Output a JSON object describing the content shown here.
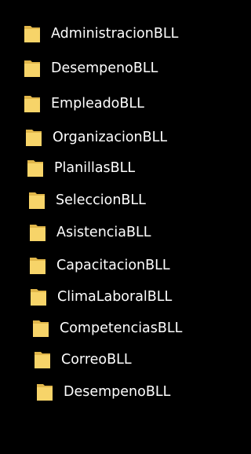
{
  "folders": [
    {
      "label": "AdministracionBLL",
      "icon": "folder-icon"
    },
    {
      "label": "DesempenoBLL",
      "icon": "folder-icon"
    },
    {
      "label": "EmpleadoBLL",
      "icon": "folder-icon"
    },
    {
      "label": "OrganizacionBLL",
      "icon": "folder-icon"
    },
    {
      "label": "PlanillasBLL",
      "icon": "folder-icon"
    },
    {
      "label": "SeleccionBLL",
      "icon": "folder-icon"
    },
    {
      "label": "AsistenciaBLL",
      "icon": "folder-icon"
    },
    {
      "label": "CapacitacionBLL",
      "icon": "folder-icon"
    },
    {
      "label": "ClimaLaboralBLL",
      "icon": "folder-icon"
    },
    {
      "label": "CompetenciasBLL",
      "icon": "folder-icon"
    },
    {
      "label": "CorreoBLL",
      "icon": "folder-icon"
    },
    {
      "label": "DesempenoBLL",
      "icon": "folder-icon"
    }
  ],
  "colors": {
    "background": "#000000",
    "text": "#ffffff",
    "folder_front": "#f7d469",
    "folder_back": "#e0b64a"
  }
}
